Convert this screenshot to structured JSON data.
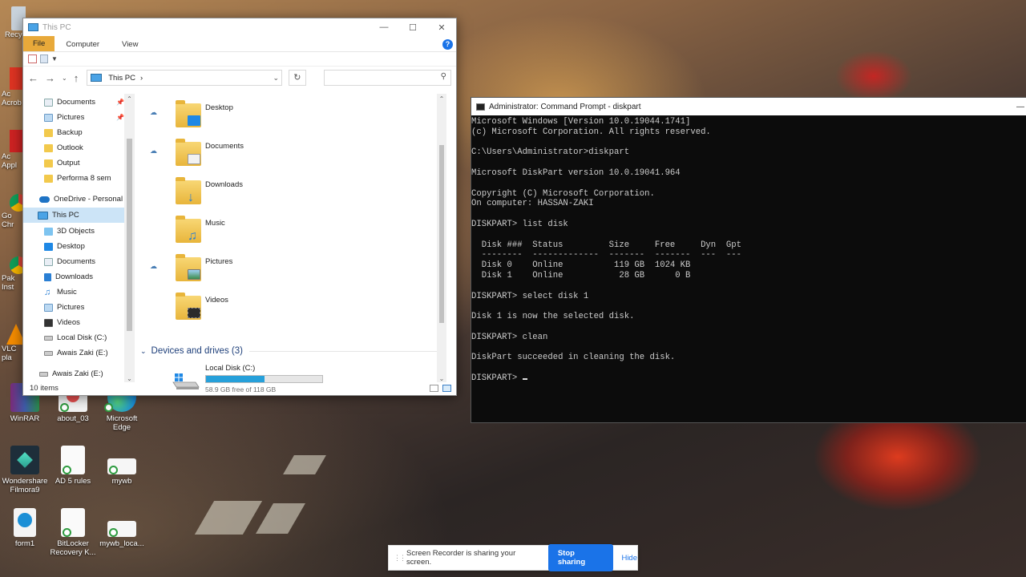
{
  "desktop": {
    "icons": [
      {
        "label": "WinRAR"
      },
      {
        "label": "about_03"
      },
      {
        "label": "Microsoft Edge"
      },
      {
        "label": "Wondershare Filmora9"
      },
      {
        "label": "AD 5 rules"
      },
      {
        "label": "mywb"
      },
      {
        "label": "form1"
      },
      {
        "label": "BitLocker Recovery K..."
      },
      {
        "label": "mywb_loca..."
      }
    ],
    "left_edge_labels": [
      "Recy",
      "Ac Acrob",
      "Ac Appl",
      "Go Chr",
      "Pak Inst",
      "VLC pla"
    ]
  },
  "explorer": {
    "title": "This PC",
    "ribbon": {
      "file": "File",
      "computer": "Computer",
      "view": "View"
    },
    "address": {
      "location": "This PC",
      "search_placeholder": ""
    },
    "nav": {
      "quick_access": [
        "Documents",
        "Pictures",
        "Backup",
        "Outlook",
        "Output",
        "Performa 8 sem"
      ],
      "onedrive": "OneDrive - Personal",
      "this_pc": "This PC",
      "this_pc_children": [
        "3D Objects",
        "Desktop",
        "Documents",
        "Downloads",
        "Music",
        "Pictures",
        "Videos",
        "Local Disk (C:)",
        "Awais Zaki (E:)"
      ],
      "cut_off_item": "Awais Zaki (E:)"
    },
    "folders": [
      "Desktop",
      "Documents",
      "Downloads",
      "Music",
      "Pictures",
      "Videos"
    ],
    "devices_header": "Devices and drives (3)",
    "drive": {
      "name": "Local Disk (C:)",
      "free_text": "58.9 GB free of 118 GB",
      "used_fraction": 0.5
    },
    "status": "10 items"
  },
  "cmd": {
    "title": "Administrator: Command Prompt - diskpart",
    "lines": [
      "Microsoft Windows [Version 10.0.19044.1741]",
      "(c) Microsoft Corporation. All rights reserved.",
      "",
      "C:\\Users\\Administrator>diskpart",
      "",
      "Microsoft DiskPart version 10.0.19041.964",
      "",
      "Copyright (C) Microsoft Corporation.",
      "On computer: HASSAN-ZAKI",
      "",
      "DISKPART> list disk",
      "",
      "  Disk ###  Status         Size     Free     Dyn  Gpt",
      "  --------  -------------  -------  -------  ---  ---",
      "  Disk 0    Online          119 GB  1024 KB",
      "  Disk 1    Online           28 GB      0 B",
      "",
      "DISKPART> select disk 1",
      "",
      "Disk 1 is now the selected disk.",
      "",
      "DISKPART> clean",
      "",
      "DiskPart succeeded in cleaning the disk.",
      ""
    ],
    "prompt": "DISKPART> "
  },
  "sharing_bar": {
    "message": "Screen Recorder is sharing your screen.",
    "stop_label": "Stop sharing",
    "hide_label": "Hide"
  }
}
